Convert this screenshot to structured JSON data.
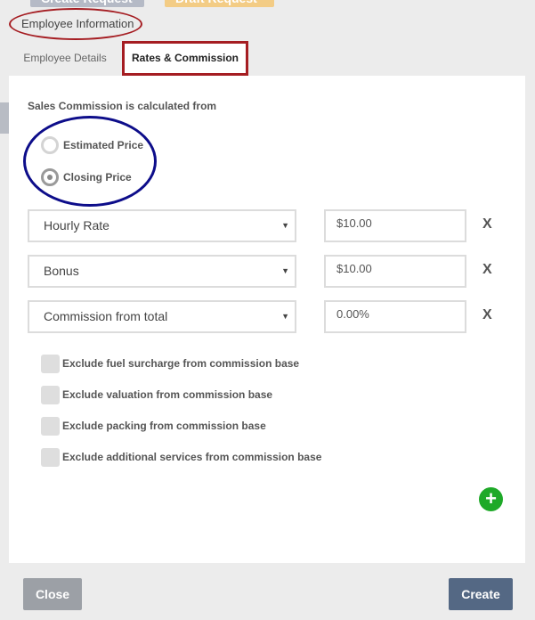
{
  "background": {
    "create_request": "Create Request",
    "draft_request": "Draft Request"
  },
  "modal": {
    "title": "Employee Information",
    "tabs": [
      {
        "label": "Employee Details",
        "active": false
      },
      {
        "label": "Rates & Commission",
        "active": true
      }
    ],
    "commission_source": {
      "label": "Sales Commission is calculated from",
      "options": [
        {
          "label": "Estimated Price",
          "selected": false
        },
        {
          "label": "Closing Price",
          "selected": true
        }
      ]
    },
    "rates": [
      {
        "type": "Hourly Rate",
        "value": "$10.00",
        "remove": "X"
      },
      {
        "type": "Bonus",
        "value": "$10.00",
        "remove": "X"
      },
      {
        "type": "Commission from total",
        "value": "0.00%",
        "remove": "X"
      }
    ],
    "exclusions": [
      {
        "label": "Exclude fuel surcharge from commission base",
        "checked": false
      },
      {
        "label": "Exclude valuation from commission base",
        "checked": false
      },
      {
        "label": "Exclude packing from commission base",
        "checked": false
      },
      {
        "label": "Exclude additional services from commission base",
        "checked": false
      }
    ],
    "add_icon": "plus-circle-icon",
    "footer": {
      "close_label": "Close",
      "create_label": "Create"
    }
  },
  "colors": {
    "annotation_red": "#a51d22",
    "annotation_blue": "#0d0d8a",
    "add_green": "#1ea928",
    "create_button": "#546884",
    "close_button": "#9ca0a6"
  }
}
